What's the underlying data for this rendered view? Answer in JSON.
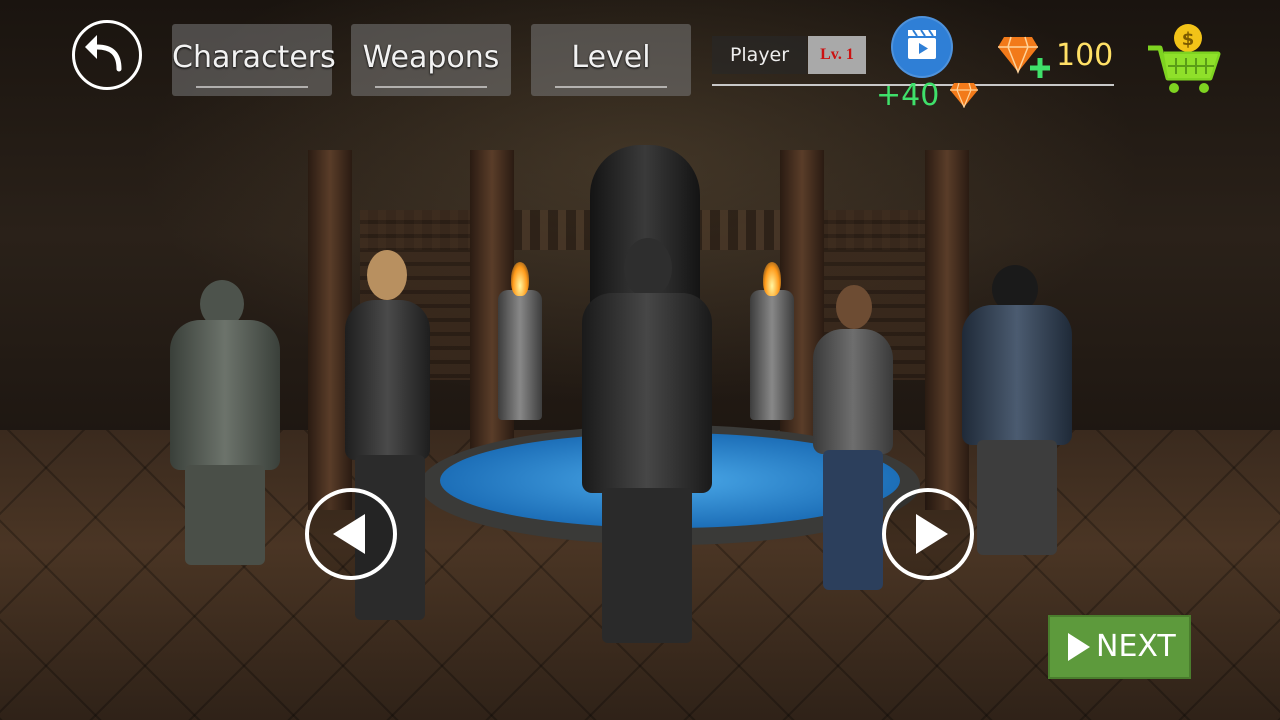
{
  "header": {
    "back_icon": "back-arrow-icon",
    "tabs": [
      {
        "label": "Characters"
      },
      {
        "label": "Weapons"
      },
      {
        "label": "Level"
      }
    ]
  },
  "player": {
    "name_label": "Player",
    "level_label": "Lv. 1"
  },
  "reward": {
    "video_icon": "video-play-icon",
    "bonus_text": "+40",
    "gem_icon": "diamond-icon"
  },
  "currency": {
    "gem_icon": "diamond-plus-icon",
    "gem_count": "100",
    "shop_icon": "shopping-cart-icon"
  },
  "navigation": {
    "prev_icon": "triangle-left-icon",
    "next_icon": "triangle-right-icon",
    "next_label": "NEXT"
  },
  "colors": {
    "reward_green": "#3fe06a",
    "gem_yellow": "#ffe066",
    "next_button": "#5d9a3c",
    "video_button": "#2f7fd6",
    "level_red": "#cc1111"
  }
}
